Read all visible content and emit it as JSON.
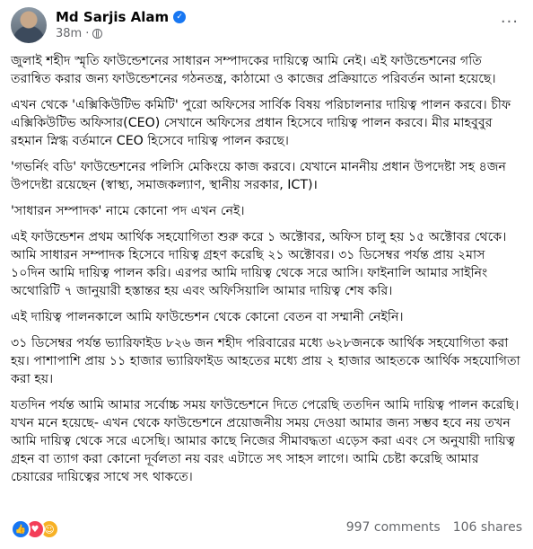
{
  "post": {
    "author": "Md Sarjis Alam",
    "time": "38m",
    "more": "···",
    "paragraphs": [
      "জুলাই শহীদ স্মৃতি ফাউন্ডেশনের সাধারন সম্পাদকের দায়িত্বে আমি নেই। এই ফাউন্ডেশনের গতি তরান্বিত করার জন্য ফাউন্ডেশনের গঠনতন্ত্র, কাঠামো ও কাজের প্রক্রিয়াতে পরিবর্তন আনা হয়েছে।",
      "এখন থেকে 'এক্সিকিউটিভ কমিটি' পুরো অফিসের সার্বিক বিষয় পরিচালনার দায়িত্ব পালন করবে। চীফ এক্সিকিউটিভ অফিসার(CEO) সেখানে অফিসের প্রধান হিসেবে দায়িত্ব পালন করবে। মীর মাহবুবুর রহমান স্নিগ্ধ বর্তমানে CEO হিসেবে দায়িত্ব পালন করছে।",
      "'গভর্নিং বডি' ফাউন্ডেশনের পলিসি মেকিংয়ে কাজ করবে। যেখানে মাননীয় প্রধান উপদেষ্টা সহ ৪জন উপদেষ্টা রয়েছেন (স্বাস্থ্য, সমাজকল্যাণ, স্থানীয় সরকার, ICT)।",
      "'সাধারন সম্পাদক' নামে কোনো পদ এখন নেই।",
      "এই ফাউন্ডেশন প্রথম আর্থিক সহযোগিতা শুরু করে ১ অক্টোবর, অফিস চালু হয় ১৫ অক্টোবর থেকে। আমি সাধারন সম্পাদক হিসেবে দায়িত্ব গ্রহণ করেছি ২১ অক্টোবর। ৩১ ডিসেম্বর পর্যন্ত প্রায় ২মাস ১০দিন আমি দায়িত্ব পালন করি। এরপর আমি দায়িত্ব থেকে সরে আসি। ফাইনালি আমার সাইনিং অথোরিটি ৭ জানুয়ারী হস্তান্তর হয় এবং অফিসিয়ালি আমার দায়িত্ব শেষ করি।",
      "এই দায়িত্ব পালনকালে আমি ফাউন্ডেশন থেকে কোনো বেতন বা সম্মানী নেইনি।",
      "৩১ ডিসেম্বর পর্যন্ত ভ্যারিফাইড ৮২৬ জন শহীদ পরিবারের মধ্যে ৬২৮জনকে আর্থিক সহযোগিতা করা হয়। পাশাপাশি প্রায় ১১ হাজার ভ্যারিফাইড আহতের মধ্যে প্রায় ২ হাজার আহতকে আর্থিক সহযোগিতা করা হয়।",
      "যতদিন পর্যন্ত আমি আমার সর্বোচ্চ সময় ফাউন্ডেশনে দিতে পেরেছি ততদিন আমি দায়িত্ব পালন করেছি। যখন মনে হয়েছে- এখন থেকে ফাউন্ডেশনে প্রয়োজনীয় সময় দেওয়া আমার জন্য সম্ভব হবে নয় তখন আমি দায়িত্ব থেকে সরে এসেছি। আমার কাছে নিজের সীমাবদ্ধতা এড়েস করা এবং সে অনুযায়ী দায়িত্ব গ্রহন বা ত্যাগ করা কোনো দূর্বলতা নয় বরং এটাতে সৎ সাহস লাগে। আমি চেষ্টা করেছি আমার চেয়ারের দায়িত্বের সাথে সৎ থাকতে।"
    ]
  },
  "engagement": {
    "comments": "997 comments",
    "shares": "106 shares"
  },
  "icons": {
    "like": "like-icon",
    "love": "love-icon",
    "care": "care-icon",
    "globe": "globe-icon",
    "verified": "verified-badge-icon"
  },
  "colors": {
    "accent": "#1877f2",
    "love": "#f33e58",
    "care": "#f7b125",
    "secondary_text": "#65676b"
  }
}
